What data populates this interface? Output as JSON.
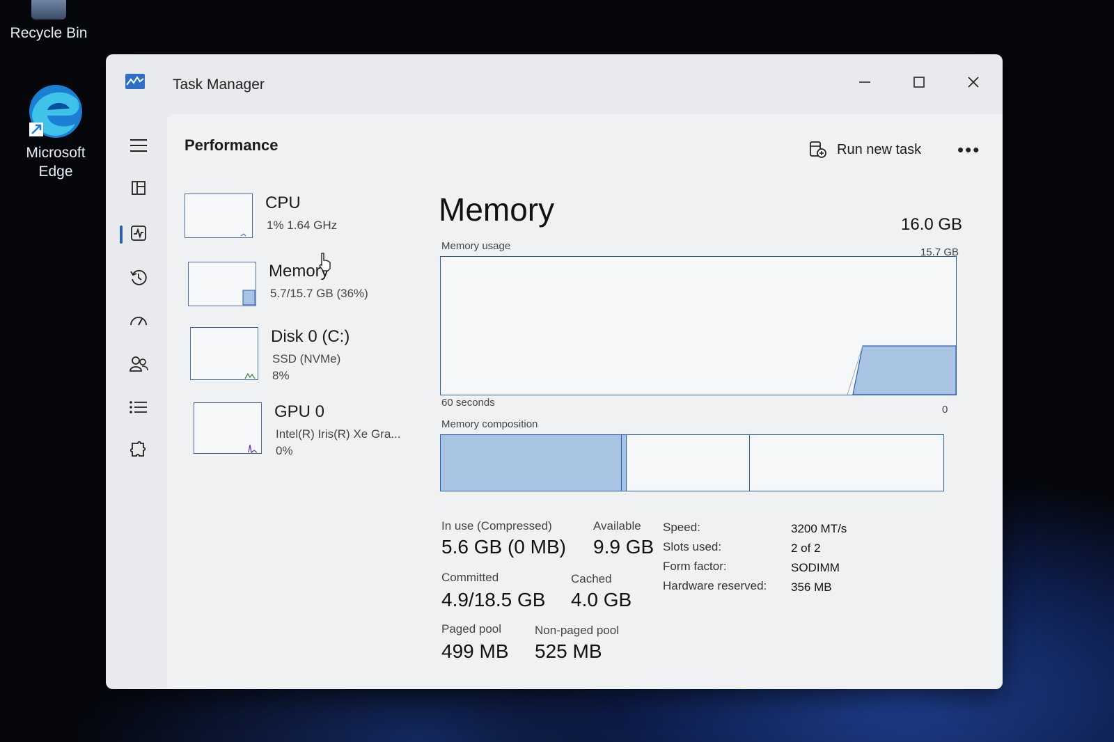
{
  "desktop": {
    "recycle_bin": "Recycle Bin",
    "edge_line1": "Microsoft",
    "edge_line2": "Edge"
  },
  "window": {
    "title": "Task Manager",
    "page_title": "Performance",
    "run_new_task": "Run new task"
  },
  "resources": [
    {
      "name": "CPU",
      "line1": "1%  1.64 GHz",
      "line2": ""
    },
    {
      "name": "Memory",
      "line1": "5.7/15.7 GB (36%)",
      "line2": ""
    },
    {
      "name": "Disk 0 (C:)",
      "line1": "SSD (NVMe)",
      "line2": "8%"
    },
    {
      "name": "GPU 0",
      "line1": "Intel(R) Iris(R) Xe Gra...",
      "line2": "0%"
    }
  ],
  "memory": {
    "title": "Memory",
    "total": "16.0 GB",
    "usage_label": "Memory usage",
    "usage_max": "15.7 GB",
    "time_span": "60 seconds",
    "axis_zero": "0",
    "composition_label": "Memory composition",
    "composition_fractions": {
      "in_use": 0.36,
      "modified": 0.01,
      "standby": 0.245,
      "free": 0.385
    }
  },
  "stats": {
    "in_use_label": "In use (Compressed)",
    "in_use_value": "5.6 GB (0 MB)",
    "available_label": "Available",
    "available_value": "9.9 GB",
    "committed_label": "Committed",
    "committed_value": "4.9/18.5 GB",
    "cached_label": "Cached",
    "cached_value": "4.0 GB",
    "paged_label": "Paged pool",
    "paged_value": "499 MB",
    "nonpaged_label": "Non-paged pool",
    "nonpaged_value": "525 MB"
  },
  "specs": {
    "speed_label": "Speed:",
    "speed_value": "3200 MT/s",
    "slots_label": "Slots used:",
    "slots_value": "2 of 2",
    "form_label": "Form factor:",
    "form_value": "SODIMM",
    "hw_label": "Hardware reserved:",
    "hw_value": "356 MB"
  },
  "colors": {
    "accent": "#2b5fad",
    "fill": "#a9c3e3"
  }
}
